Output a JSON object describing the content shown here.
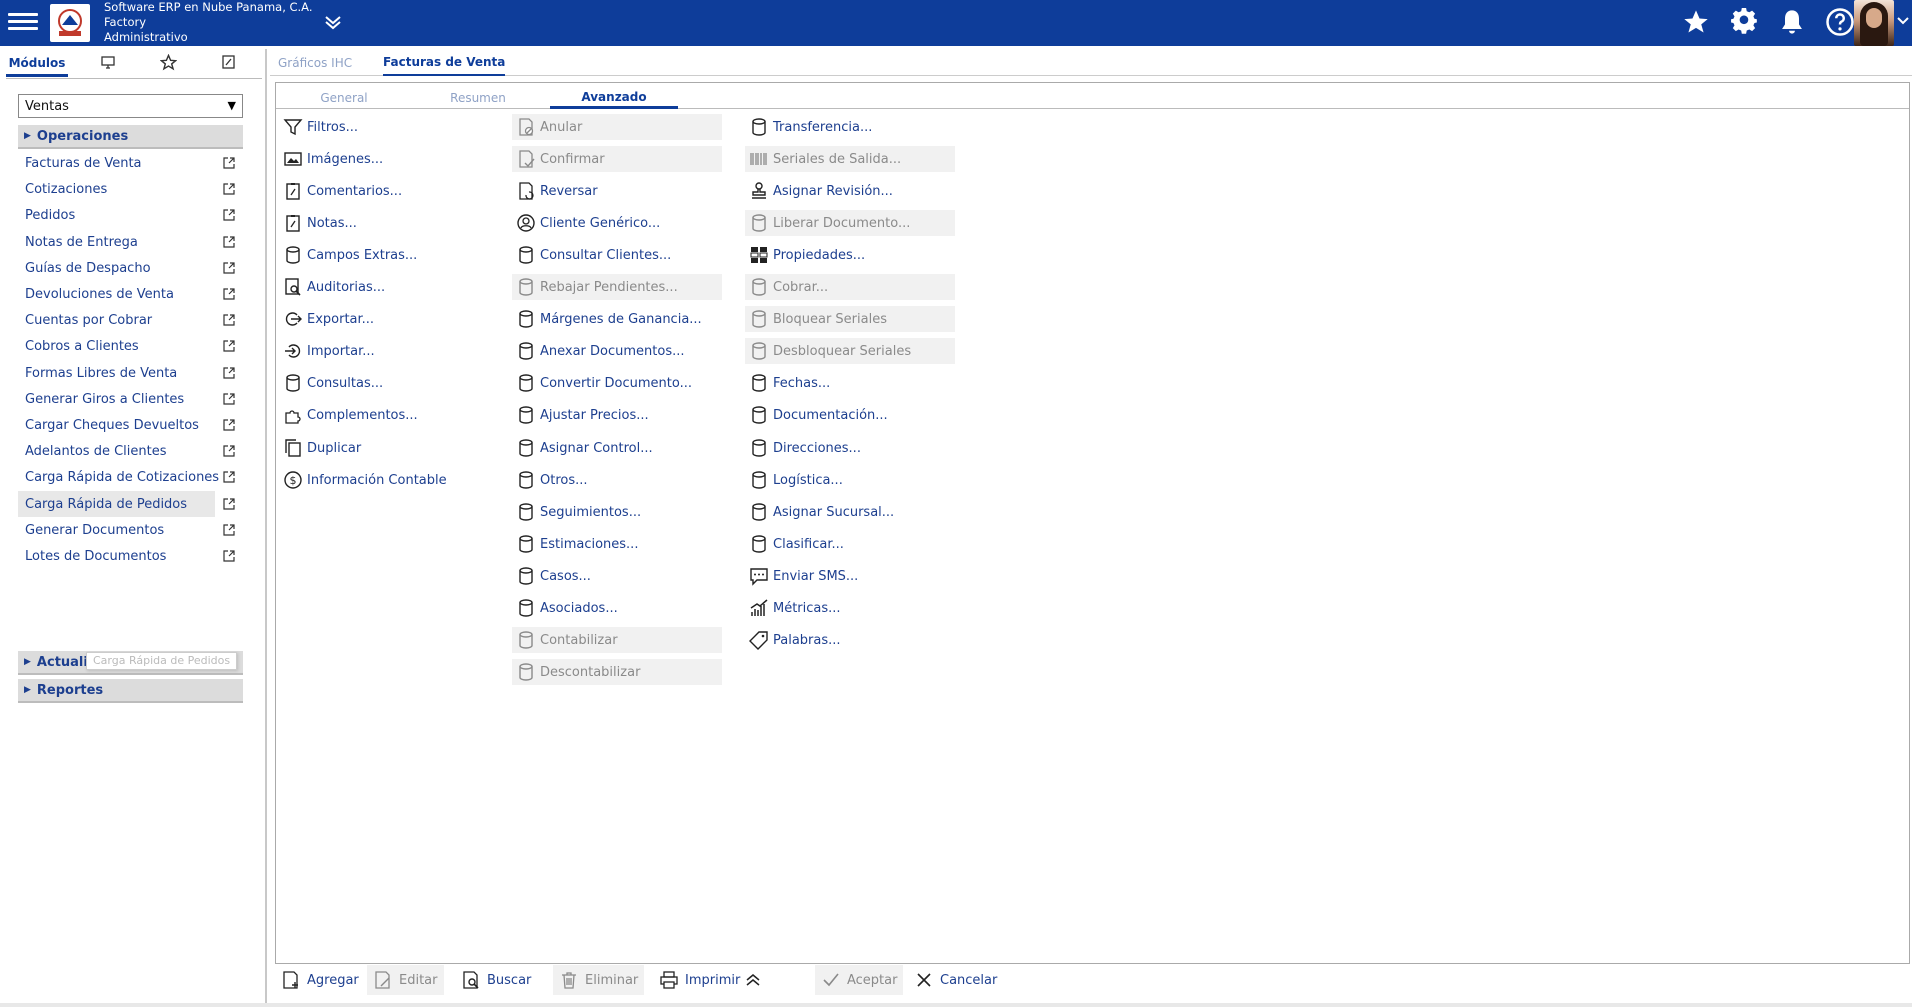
{
  "header": {
    "company": "Software ERP en Nube Panama, C.A.",
    "line2": "Factory",
    "line3": "Administrativo",
    "bg_color": "#0e3d9a"
  },
  "left_tabs": [
    {
      "label": "Módulos",
      "icon": "modules"
    },
    {
      "label": "",
      "icon": "monitor-icon"
    },
    {
      "label": "",
      "icon": "star-icon"
    },
    {
      "label": "",
      "icon": "notepad-icon"
    }
  ],
  "module_select": {
    "value": "Ventas"
  },
  "groups": {
    "operaciones": "Operaciones",
    "actualizaciones": "Actualizaciones",
    "reportes": "Reportes"
  },
  "menu_items": [
    "Facturas de Venta",
    "Cotizaciones",
    "Pedidos",
    "Notas de Entrega",
    "Guías de Despacho",
    "Devoluciones de Venta",
    "Cuentas por Cobrar",
    "Cobros a Clientes",
    "Formas Libres de Venta",
    "Generar Giros a Clientes",
    "Cargar Cheques Devueltos",
    "Adelantos de Clientes",
    "Carga Rápida de Cotizaciones",
    "Carga Rápida de Pedidos",
    "Generar Documentos",
    "Lotes de Documentos"
  ],
  "tooltip": "Carga Rápida de Pedidos",
  "doc_tabs": [
    {
      "label": "Gráficos IHC",
      "active": false
    },
    {
      "label": "Facturas de Venta",
      "active": true
    }
  ],
  "sub_tabs": [
    {
      "label": "General",
      "active": false
    },
    {
      "label": "Resumen",
      "active": false
    },
    {
      "label": "Avanzado",
      "active": true
    }
  ],
  "actions_col1": [
    {
      "label": "Filtros...",
      "icon": "funnel-icon",
      "disabled": false
    },
    {
      "label": "Imágenes...",
      "icon": "image-icon",
      "disabled": false
    },
    {
      "label": "Comentarios...",
      "icon": "clipboard-icon",
      "disabled": false
    },
    {
      "label": "Notas...",
      "icon": "clipboard-icon",
      "disabled": false
    },
    {
      "label": "Campos Extras...",
      "icon": "database-icon",
      "disabled": false
    },
    {
      "label": "Auditorias...",
      "icon": "audit-icon",
      "disabled": false
    },
    {
      "label": "Exportar...",
      "icon": "export-icon",
      "disabled": false
    },
    {
      "label": "Importar...",
      "icon": "import-icon",
      "disabled": false
    },
    {
      "label": "Consultas...",
      "icon": "database-icon",
      "disabled": false
    },
    {
      "label": "Complementos...",
      "icon": "puzzle-icon",
      "disabled": false
    },
    {
      "label": "Duplicar",
      "icon": "copy-icon",
      "disabled": false
    },
    {
      "label": "Información Contable",
      "icon": "dollar-icon",
      "disabled": false
    }
  ],
  "actions_col2": [
    {
      "label": "Anular",
      "icon": "void-icon",
      "disabled": true
    },
    {
      "label": "Confirmar",
      "icon": "confirm-icon",
      "disabled": true
    },
    {
      "label": "Reversar",
      "icon": "reverse-icon",
      "disabled": false
    },
    {
      "label": "Cliente Genérico...",
      "icon": "user-icon",
      "disabled": false
    },
    {
      "label": "Consultar Clientes...",
      "icon": "database-icon",
      "disabled": false
    },
    {
      "label": "Rebajar Pendientes...",
      "icon": "database-icon",
      "disabled": true
    },
    {
      "label": "Márgenes de Ganancia...",
      "icon": "database-icon",
      "disabled": false
    },
    {
      "label": "Anexar Documentos...",
      "icon": "database-icon",
      "disabled": false
    },
    {
      "label": "Convertir Documento...",
      "icon": "database-icon",
      "disabled": false
    },
    {
      "label": "Ajustar Precios...",
      "icon": "database-icon",
      "disabled": false
    },
    {
      "label": "Asignar Control...",
      "icon": "database-icon",
      "disabled": false
    },
    {
      "label": "Otros...",
      "icon": "database-icon",
      "disabled": false
    },
    {
      "label": "Seguimientos...",
      "icon": "database-icon",
      "disabled": false
    },
    {
      "label": "Estimaciones...",
      "icon": "database-icon",
      "disabled": false
    },
    {
      "label": "Casos...",
      "icon": "database-icon",
      "disabled": false
    },
    {
      "label": "Asociados...",
      "icon": "database-icon",
      "disabled": false
    },
    {
      "label": "Contabilizar",
      "icon": "database-icon",
      "disabled": true
    },
    {
      "label": "Descontabilizar",
      "icon": "database-icon",
      "disabled": true
    }
  ],
  "actions_col3": [
    {
      "label": "Transferencia...",
      "icon": "database-icon",
      "disabled": false
    },
    {
      "label": "Seriales de Salida...",
      "icon": "barcode-icon",
      "disabled": true
    },
    {
      "label": "Asignar Revisión...",
      "icon": "stamp-icon",
      "disabled": false
    },
    {
      "label": "Liberar Documento...",
      "icon": "database-icon",
      "disabled": true
    },
    {
      "label": "Propiedades...",
      "icon": "grid-icon",
      "disabled": false
    },
    {
      "label": "Cobrar...",
      "icon": "database-icon",
      "disabled": true
    },
    {
      "label": "Bloquear Seriales",
      "icon": "database-icon",
      "disabled": true
    },
    {
      "label": "Desbloquear Seriales",
      "icon": "database-icon",
      "disabled": true
    },
    {
      "label": "Fechas...",
      "icon": "database-icon",
      "disabled": false
    },
    {
      "label": "Documentación...",
      "icon": "database-icon",
      "disabled": false
    },
    {
      "label": "Direcciones...",
      "icon": "database-icon",
      "disabled": false
    },
    {
      "label": "Logística...",
      "icon": "database-icon",
      "disabled": false
    },
    {
      "label": "Asignar Sucursal...",
      "icon": "database-icon",
      "disabled": false
    },
    {
      "label": "Clasificar...",
      "icon": "database-icon",
      "disabled": false
    },
    {
      "label": "Enviar SMS...",
      "icon": "sms-icon",
      "disabled": false
    },
    {
      "label": "Métricas...",
      "icon": "metrics-icon",
      "disabled": false
    },
    {
      "label": "Palabras...",
      "icon": "tag-icon",
      "disabled": false
    }
  ],
  "bottom_buttons": [
    {
      "label": "Agregar",
      "icon": "add-doc-icon",
      "disabled": false
    },
    {
      "label": "Editar",
      "icon": "edit-icon",
      "disabled": true
    },
    {
      "label": "Buscar",
      "icon": "search-doc-icon",
      "disabled": false
    },
    {
      "label": "Eliminar",
      "icon": "trash-icon",
      "disabled": true
    },
    {
      "label": "Imprimir",
      "icon": "printer-icon",
      "disabled": false
    },
    {
      "label": "Aceptar",
      "icon": "check-icon",
      "disabled": true
    },
    {
      "label": "Cancelar",
      "icon": "x-icon",
      "disabled": false
    }
  ]
}
